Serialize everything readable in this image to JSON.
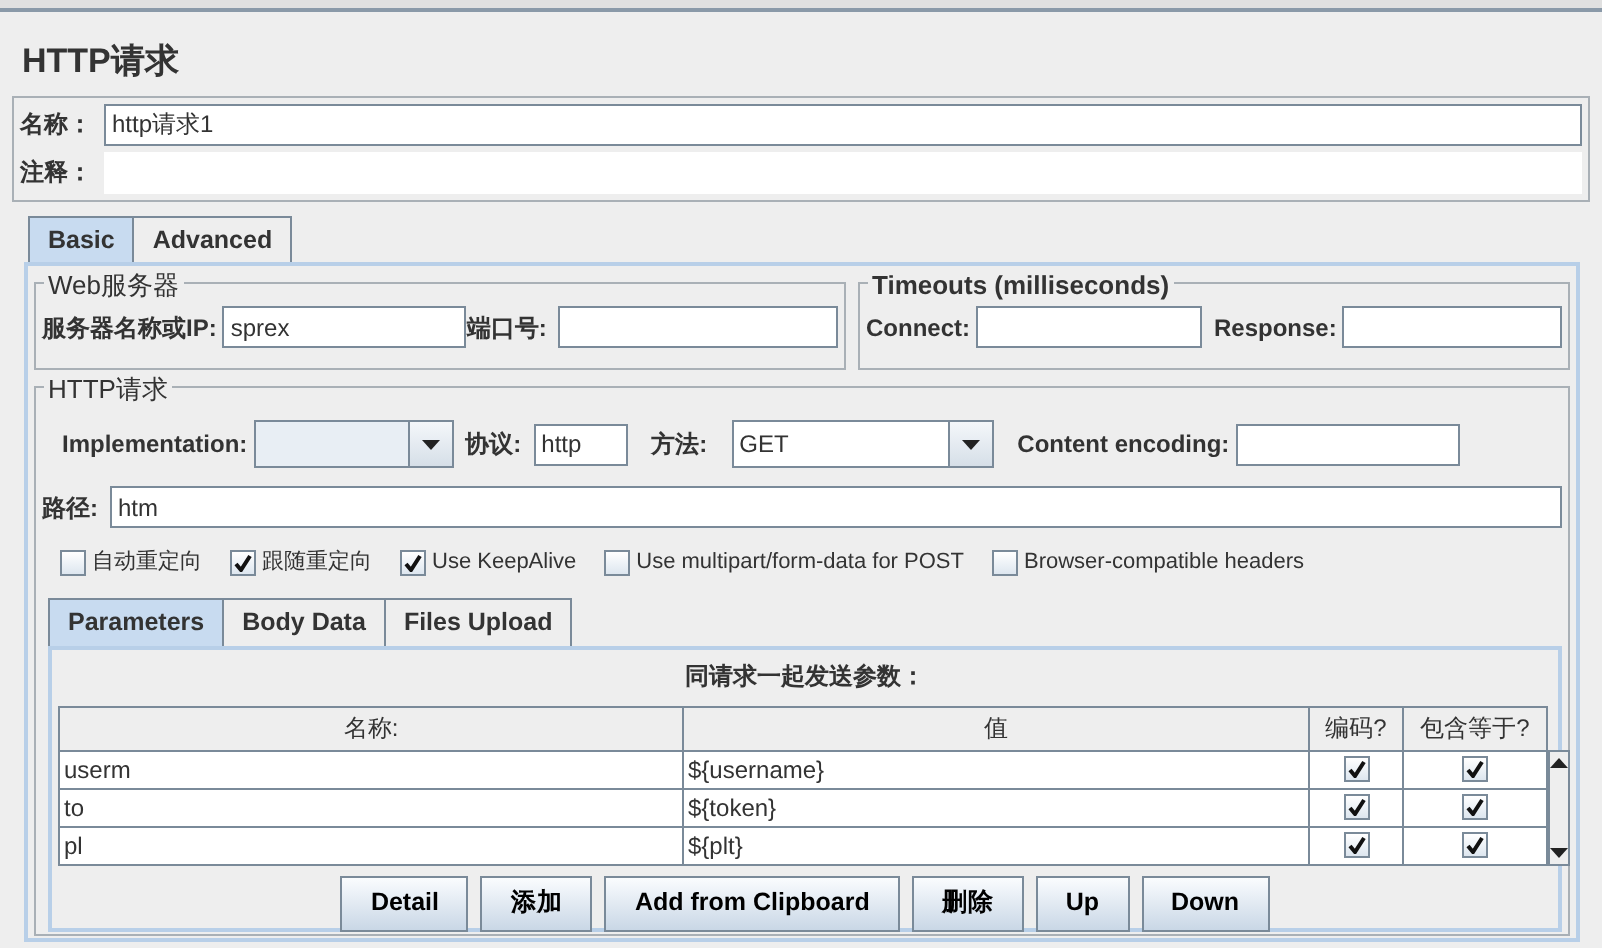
{
  "title": "HTTP请求",
  "name_field": {
    "label": "名称：",
    "value": "http请求1"
  },
  "comment_field": {
    "label": "注释："
  },
  "tabs": [
    {
      "label": "Basic",
      "selected": true
    },
    {
      "label": "Advanced",
      "selected": false
    }
  ],
  "web_server": {
    "legend": "Web服务器",
    "server_label": "服务器名称或IP:",
    "server_value": "sprex",
    "port_label": "端口号:"
  },
  "timeouts": {
    "legend": "Timeouts (milliseconds)",
    "connect_label": "Connect:",
    "response_label": "Response:"
  },
  "http_request": {
    "legend": "HTTP请求",
    "implementation_label": "Implementation:",
    "protocol_label": "协议:",
    "protocol_value": "http",
    "method_label": "方法:",
    "method_value": "GET",
    "encoding_label": "Content encoding:",
    "path_label": "路径:",
    "path_value": "htm"
  },
  "options": [
    {
      "label": "自动重定向",
      "checked": false
    },
    {
      "label": "跟随重定向",
      "checked": true
    },
    {
      "label": "Use KeepAlive",
      "checked": true
    },
    {
      "label": "Use multipart/form-data for POST",
      "checked": false
    },
    {
      "label": "Browser-compatible headers",
      "checked": false
    }
  ],
  "param_tabs": [
    {
      "label": "Parameters",
      "selected": true
    },
    {
      "label": "Body Data",
      "selected": false
    },
    {
      "label": "Files Upload",
      "selected": false
    }
  ],
  "params": {
    "caption": "同请求一起发送参数：",
    "columns": [
      "名称:",
      "值",
      "编码?",
      "包含等于?"
    ],
    "rows": [
      {
        "name": "userm",
        "value": "${username}",
        "encode": true,
        "include_equals": true
      },
      {
        "name": "to",
        "value": "${token}",
        "encode": true,
        "include_equals": true
      },
      {
        "name": "pl",
        "value": "${plt}",
        "encode": true,
        "include_equals": true
      }
    ]
  },
  "buttons": [
    "Detail",
    "添加",
    "Add from Clipboard",
    "删除",
    "Up",
    "Down"
  ]
}
